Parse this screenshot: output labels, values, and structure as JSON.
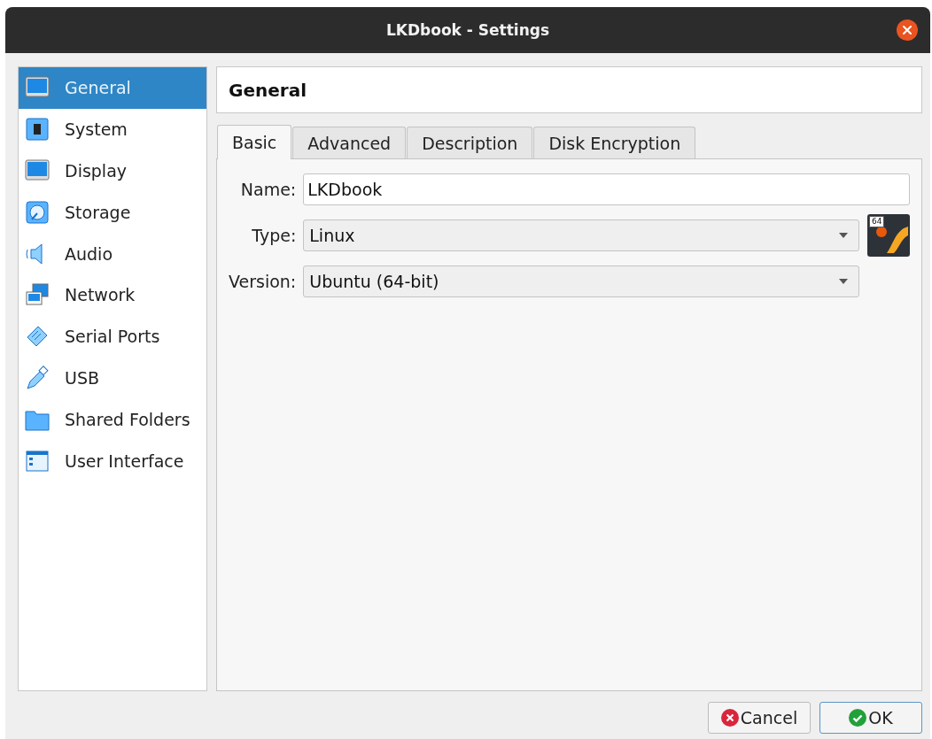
{
  "window": {
    "title": "LKDbook - Settings"
  },
  "sidebar": {
    "items": [
      {
        "kind": "general",
        "label": "General",
        "selected": true
      },
      {
        "kind": "system",
        "label": "System",
        "selected": false
      },
      {
        "kind": "display",
        "label": "Display",
        "selected": false
      },
      {
        "kind": "storage",
        "label": "Storage",
        "selected": false
      },
      {
        "kind": "audio",
        "label": "Audio",
        "selected": false
      },
      {
        "kind": "network",
        "label": "Network",
        "selected": false
      },
      {
        "kind": "serial",
        "label": "Serial Ports",
        "selected": false
      },
      {
        "kind": "usb",
        "label": "USB",
        "selected": false
      },
      {
        "kind": "folders",
        "label": "Shared Folders",
        "selected": false
      },
      {
        "kind": "ui",
        "label": "User Interface",
        "selected": false
      }
    ]
  },
  "page_title": "General",
  "tabs": [
    {
      "label": "Basic",
      "selected": true
    },
    {
      "label": "Advanced",
      "selected": false
    },
    {
      "label": "Description",
      "selected": false
    },
    {
      "label": "Disk Encryption",
      "selected": false
    }
  ],
  "form": {
    "name": {
      "label": "Name:",
      "value": "LKDbook"
    },
    "type": {
      "label": "Type:",
      "value": "Linux"
    },
    "version": {
      "label": "Version:",
      "value": "Ubuntu (64-bit)"
    },
    "os_badge": "64"
  },
  "buttons": [
    {
      "kind": "cancel",
      "label": "Cancel"
    },
    {
      "kind": "ok",
      "label": "OK"
    }
  ]
}
